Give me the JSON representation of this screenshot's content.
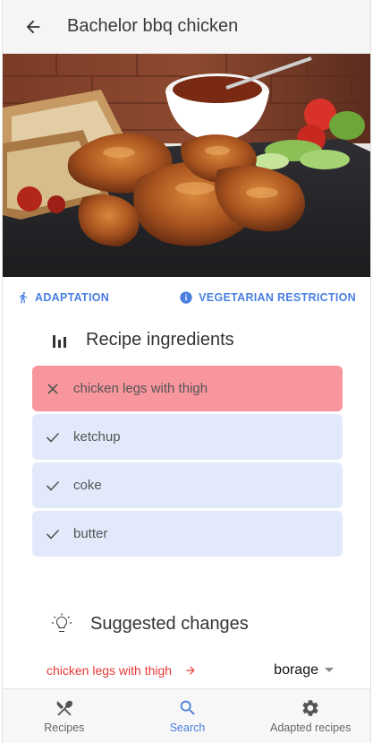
{
  "header": {
    "title": "Bachelor bbq chicken"
  },
  "chips": {
    "adaptation": "ADAPTATION",
    "restriction": "VEGETARIAN RESTRICTION"
  },
  "ingredients_section": {
    "title": "Recipe ingredients"
  },
  "ingredients": [
    {
      "label": "chicken legs with thigh",
      "status": "removed"
    },
    {
      "label": "ketchup",
      "status": "kept"
    },
    {
      "label": "coke",
      "status": "kept"
    },
    {
      "label": "butter",
      "status": "kept"
    }
  ],
  "suggestions_section": {
    "title": "Suggested changes"
  },
  "suggestion": {
    "from": "chicken legs with thigh",
    "to": "borage"
  },
  "nav": {
    "recipes": "Recipes",
    "search": "Search",
    "adapted": "Adapted recipes"
  },
  "colors": {
    "accent": "#4a7fe0",
    "removed_bg": "#f7969c",
    "kept_bg": "#e2e9fb",
    "warning_text": "#e53935"
  }
}
